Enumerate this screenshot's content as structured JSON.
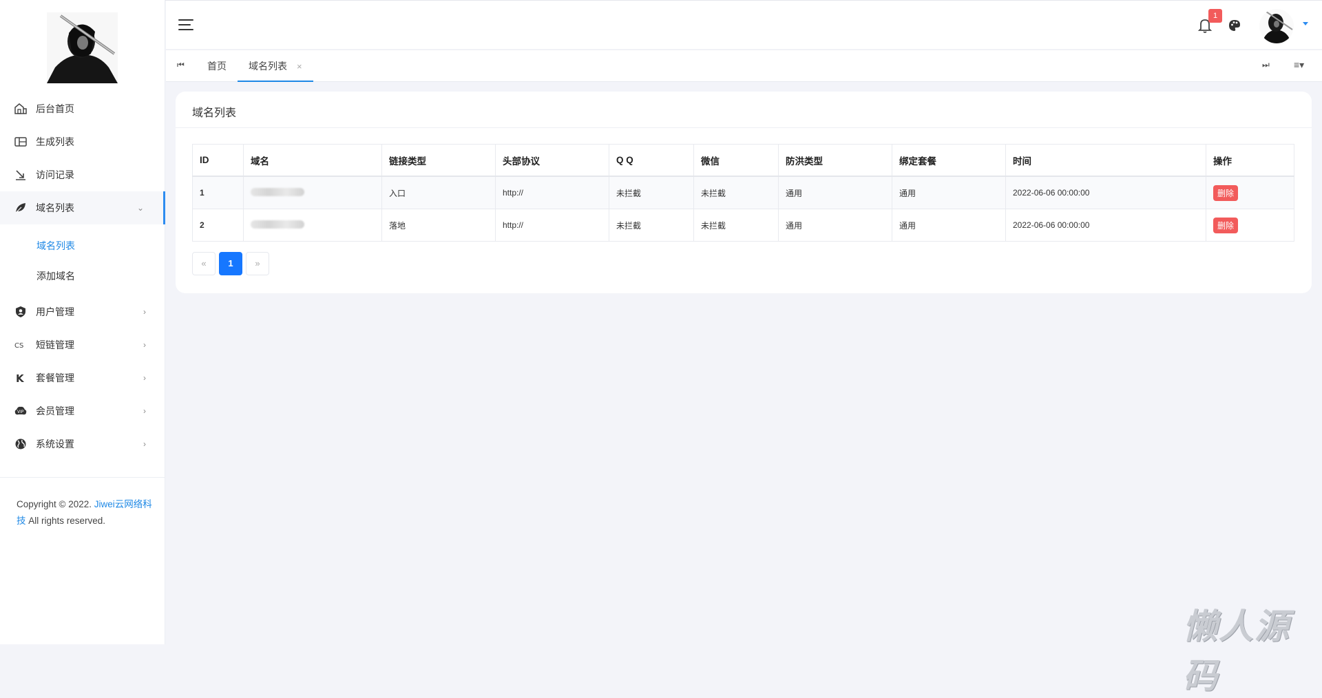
{
  "sidebar": {
    "items": [
      {
        "label": "后台首页",
        "icon": "home-icon"
      },
      {
        "label": "生成列表",
        "icon": "list-icon"
      },
      {
        "label": "访问记录",
        "icon": "history-icon"
      },
      {
        "label": "域名列表",
        "icon": "leaf-icon",
        "expanded": true
      },
      {
        "label": "用户管理",
        "icon": "shield-user-icon"
      },
      {
        "label": "短链管理",
        "icon": "link-icon"
      },
      {
        "label": "套餐管理",
        "icon": "k-icon"
      },
      {
        "label": "会员管理",
        "icon": "vip-icon"
      },
      {
        "label": "系统设置",
        "icon": "globe-icon"
      }
    ],
    "subitems": [
      {
        "label": "域名列表",
        "active": true
      },
      {
        "label": "添加域名",
        "active": false
      }
    ],
    "copyright": {
      "prefix": "Copyright © 2022. ",
      "link": "Jiwei云网络科技",
      "suffix": " All rights reserved."
    }
  },
  "header": {
    "notification_count": "1"
  },
  "tabs": {
    "items": [
      {
        "label": "首页",
        "active": false
      },
      {
        "label": "域名列表",
        "active": true,
        "close": "×"
      }
    ]
  },
  "card": {
    "title": "域名列表",
    "columns": [
      "ID",
      "域名",
      "链接类型",
      "头部协议",
      "Q Q",
      "微信",
      "防洪类型",
      "绑定套餐",
      "时间",
      "操作"
    ],
    "rows": [
      {
        "id": "1",
        "type": "入口",
        "protocol": "http://",
        "qq": "未拦截",
        "wechat": "未拦截",
        "flood": "通用",
        "package": "通用",
        "time": "2022-06-06 00:00:00",
        "action": "删除"
      },
      {
        "id": "2",
        "type": "落地",
        "protocol": "http://",
        "qq": "未拦截",
        "wechat": "未拦截",
        "flood": "通用",
        "package": "通用",
        "time": "2022-06-06 00:00:00",
        "action": "删除"
      }
    ],
    "pagination": {
      "prev": "«",
      "current": "1",
      "next": "»"
    }
  },
  "watermark": "懒人源码",
  "colors": {
    "accent": "#1e88e5",
    "danger": "#f25b5b",
    "success": "#1a8a1a",
    "page_bg": "#f3f4f9"
  }
}
